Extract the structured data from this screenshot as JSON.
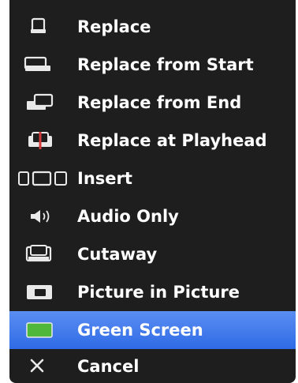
{
  "menu": {
    "items": [
      {
        "label": "Replace",
        "icon": "replace-icon"
      },
      {
        "label": "Replace from Start",
        "icon": "replace-from-start-icon"
      },
      {
        "label": "Replace from End",
        "icon": "replace-from-end-icon"
      },
      {
        "label": "Replace at Playhead",
        "icon": "replace-at-playhead-icon"
      },
      {
        "label": "Insert",
        "icon": "insert-icon"
      },
      {
        "label": "Audio Only",
        "icon": "speaker-icon"
      },
      {
        "label": "Cutaway",
        "icon": "cutaway-icon"
      },
      {
        "label": "Picture in Picture",
        "icon": "picture-in-picture-icon"
      },
      {
        "label": "Green Screen",
        "icon": "green-screen-icon"
      },
      {
        "label": "Cancel",
        "icon": "close-icon"
      }
    ],
    "selected_index": 8,
    "colors": {
      "background": "#1e1e1e",
      "selection": "#3a74ea",
      "playhead": "#d23a3a",
      "green_screen": "#4fb83a"
    }
  }
}
